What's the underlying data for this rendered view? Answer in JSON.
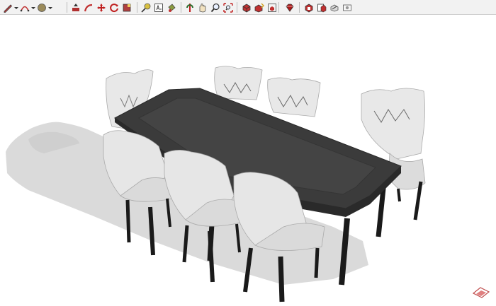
{
  "app": {
    "background": "#ffffff"
  },
  "toolbar": {
    "groups": [
      {
        "name": "draw-tools",
        "buttons": [
          "pencil-line-icon",
          "arc-icon",
          "circle-icon"
        ]
      },
      {
        "name": "modify-tools",
        "buttons": [
          "pushpull-icon",
          "follow-me-icon",
          "move-icon",
          "rotate-icon",
          "scale-icon"
        ]
      },
      {
        "name": "construction-tools",
        "buttons": [
          "tape-measure-icon",
          "text-icon",
          "paint-bucket-icon"
        ]
      },
      {
        "name": "camera-tools",
        "buttons": [
          "orbit-icon",
          "pan-icon",
          "zoom-icon",
          "zoom-extents-icon"
        ]
      },
      {
        "name": "warehouse-tools",
        "buttons": [
          "get-models-icon",
          "share-model-icon",
          "share-component-icon"
        ]
      },
      {
        "name": "ruby-tools",
        "buttons": [
          "ruby-icon"
        ]
      },
      {
        "name": "extension-tools",
        "buttons": [
          "extension-warehouse-icon",
          "layout-icon",
          "style-builder-icon",
          "photo-icon"
        ]
      }
    ]
  },
  "scene": {
    "objects": [
      "dining-table",
      "chair-back-left",
      "chair-back-middle-left",
      "chair-back-middle-right",
      "chair-head-right",
      "chair-front-left",
      "chair-front-middle",
      "chair-front-right"
    ],
    "colors": {
      "tabletop": "#3b3b3b",
      "tabletop_inset": "#444444",
      "table_edge": "#2a2a2a",
      "chair_fabric": "#e8e8e8",
      "chair_shade": "#cfcfcf",
      "chair_legs": "#1a1a1a",
      "shadow": "#d9d9d9"
    }
  }
}
